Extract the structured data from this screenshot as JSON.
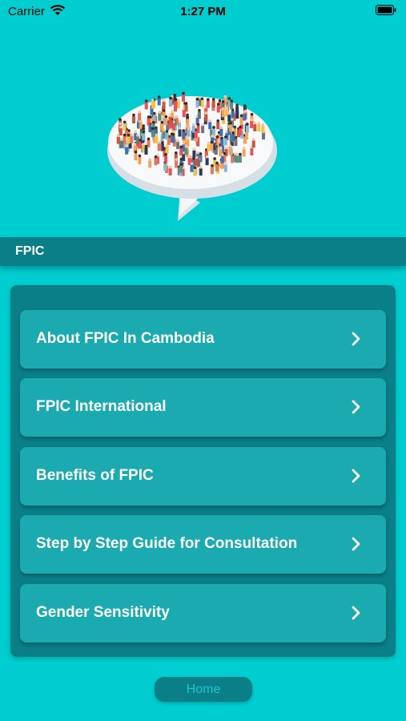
{
  "status_bar": {
    "carrier": "Carrier",
    "time": "1:27 PM"
  },
  "header": {
    "title": "FPIC"
  },
  "menu": {
    "items": [
      {
        "label": "About FPIC In Cambodia",
        "icon": "chevron-right-icon"
      },
      {
        "label": "FPIC International",
        "icon": "chevron-right-icon"
      },
      {
        "label": "Benefits of FPIC",
        "icon": "chevron-right-icon"
      },
      {
        "label": "Step by Step Guide for Consultation",
        "icon": "chevron-right-icon"
      },
      {
        "label": "Gender Sensitivity",
        "icon": "chevron-right-icon"
      }
    ]
  },
  "home_button": {
    "label": "Home"
  },
  "colors": {
    "background": "#00CDCF",
    "header_bar": "#0A7F88",
    "menu_item": "#1AAAB0",
    "text": "#FFFFFF"
  }
}
